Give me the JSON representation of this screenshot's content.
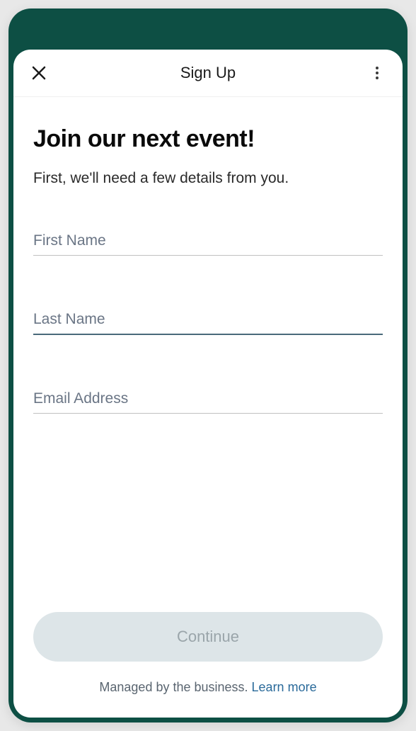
{
  "header": {
    "title": "Sign Up"
  },
  "body": {
    "heading": "Join our next event!",
    "subheading": "First, we'll need a few details from you."
  },
  "form": {
    "firstName": {
      "placeholder": "First Name",
      "value": ""
    },
    "lastName": {
      "placeholder": "Last Name",
      "value": ""
    },
    "email": {
      "placeholder": "Email Address",
      "value": ""
    }
  },
  "footer": {
    "buttonLabel": "Continue",
    "managedText": "Managed by the business. ",
    "learnMoreLabel": "Learn more"
  }
}
